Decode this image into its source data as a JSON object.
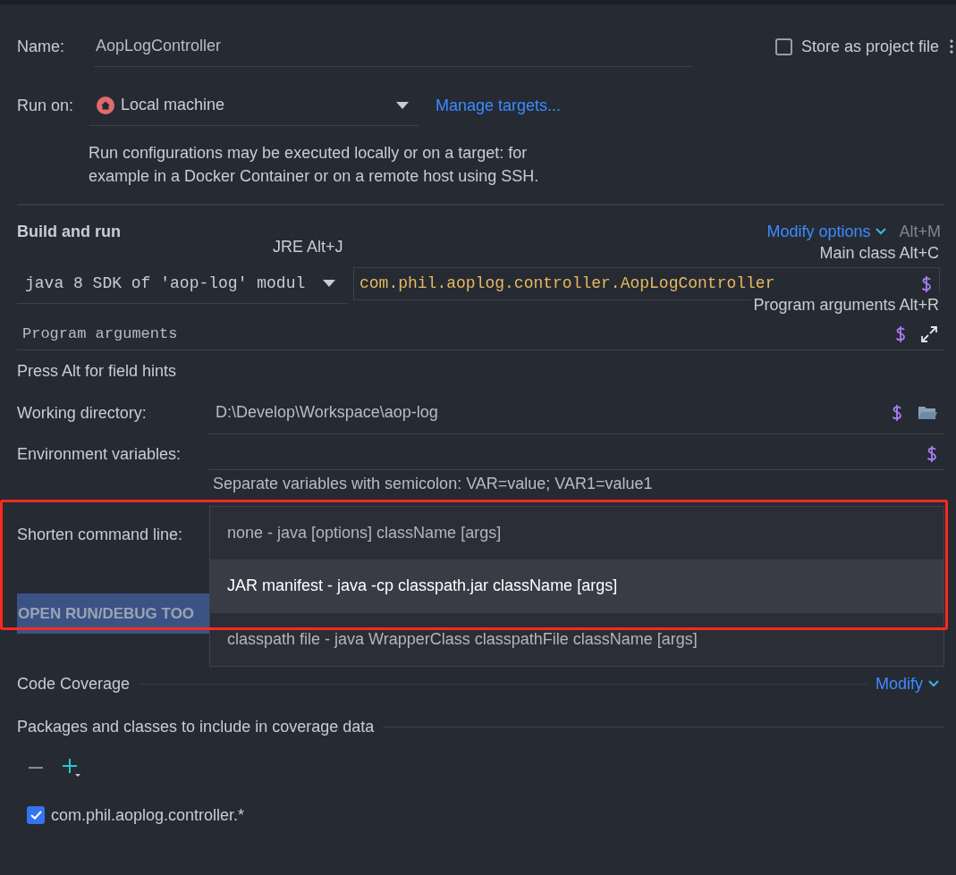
{
  "name_field": {
    "label": "Name:",
    "value": "AopLogController"
  },
  "store_as_project_file": {
    "label": "Store as project file",
    "checked": false
  },
  "run_on": {
    "label": "Run on:",
    "value": "Local machine",
    "link": "Manage targets...",
    "description_lines": [
      "Run configurations may be executed locally or on a target: for",
      "example in a Docker Container or on a remote host using SSH."
    ]
  },
  "build_and_run": {
    "title": "Build and run",
    "modify_link": "Modify options",
    "modify_shortcut": "Alt+M",
    "jre_hint": "JRE Alt+J",
    "main_class_hint": "Main class Alt+C",
    "program_args_hint": "Program arguments Alt+R",
    "jre": "java 8 SDK of 'aop-log' modul",
    "main_class": "com.phil.aoplog.controller.AopLogController",
    "program_arguments_placeholder": "Program arguments",
    "field_hint": "Press Alt for field hints"
  },
  "working_directory": {
    "label": "Working directory:",
    "value": "D:\\Develop\\Workspace\\aop-log"
  },
  "environment_variables": {
    "label": "Environment variables:",
    "hint": "Separate variables with semicolon: VAR=value; VAR1=value1"
  },
  "shorten_command_line": {
    "label": "Shorten command line:",
    "options": [
      {
        "label": "none - java [options] className [args]",
        "selected": false
      },
      {
        "label": "JAR manifest - java -cp classpath.jar className [args]",
        "selected": true
      },
      {
        "label": "classpath file - java WrapperClass classpathFile className [args]",
        "selected": false
      }
    ]
  },
  "open_tool_window_button": "OPEN RUN/DEBUG TOO",
  "code_coverage": {
    "title": "Code Coverage",
    "modify_link": "Modify",
    "packages_title": "Packages and classes to include in coverage data",
    "patterns": [
      {
        "label": "com.phil.aoplog.controller.*",
        "checked": true
      }
    ]
  }
}
